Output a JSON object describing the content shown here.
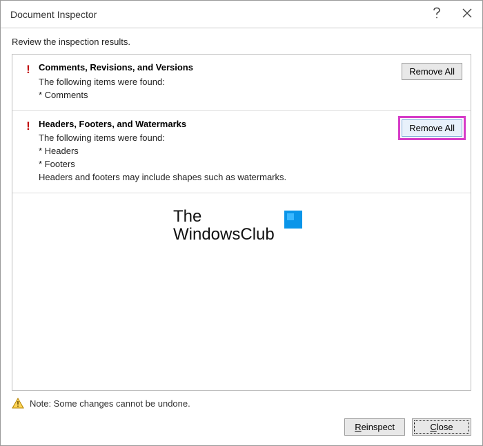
{
  "titlebar": {
    "title": "Document Inspector"
  },
  "subtitle": "Review the inspection results.",
  "results": {
    "item0": {
      "title": "Comments, Revisions, and Versions",
      "line1": "The following items were found:",
      "line2": "* Comments",
      "remove_label": "Remove All"
    },
    "item1": {
      "title": "Headers, Footers, and Watermarks",
      "line1": "The following items were found:",
      "line2": "* Headers",
      "line3": "* Footers",
      "line4": "Headers and footers may include shapes such as watermarks.",
      "remove_label": "Remove All"
    }
  },
  "watermark": {
    "line1": "The",
    "line2": "WindowsClub"
  },
  "footer": {
    "note": "Note: Some changes cannot be undone.",
    "reinspect_label": "Reinspect",
    "close_label": "Close"
  }
}
